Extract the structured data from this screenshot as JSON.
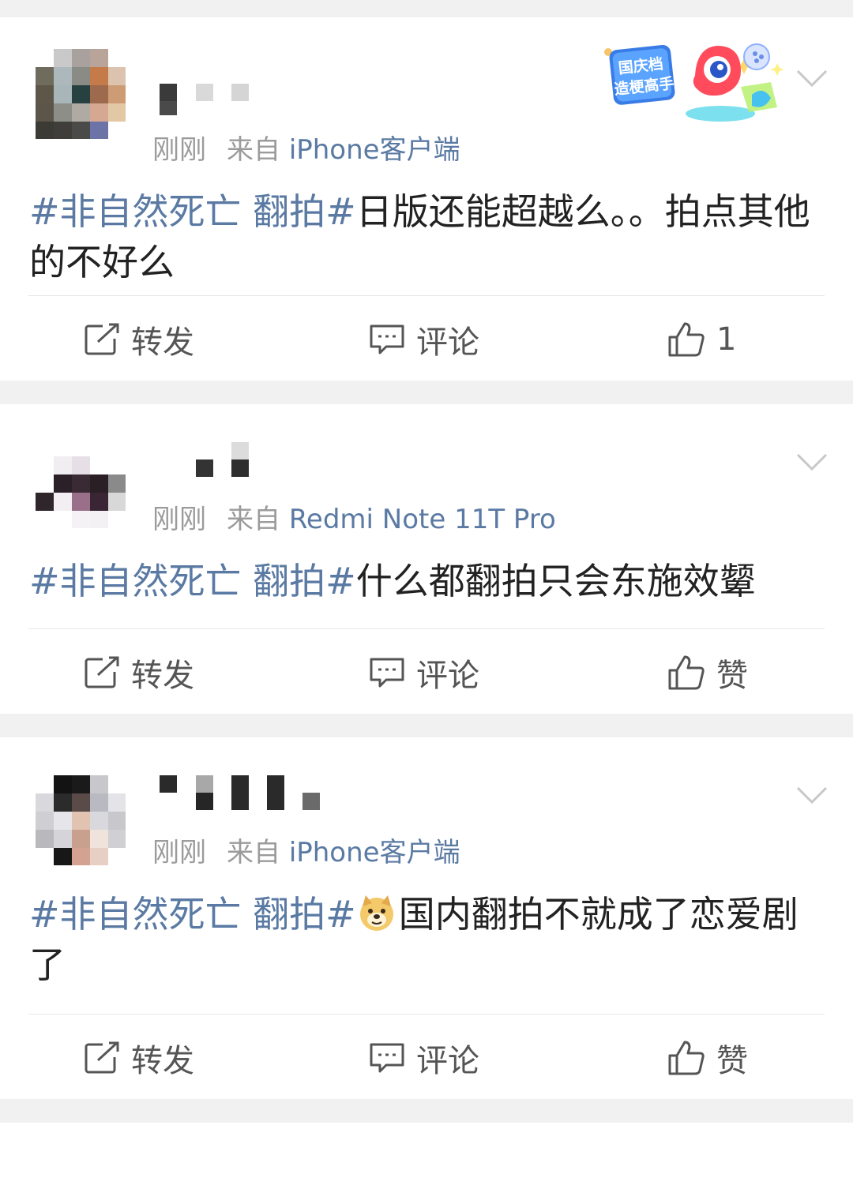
{
  "feed": {
    "posts": [
      {
        "time": "刚刚",
        "source_prefix": "来自",
        "source": "iPhone客户端",
        "hashtag": "#非自然死亡 翻拍#",
        "text": "日版还能超越么。。拍点其他的不好么",
        "badge": {
          "line1": "国庆档",
          "line2": "造梗高手"
        },
        "actions": {
          "repost": "转发",
          "comment": "评论",
          "like": "1"
        }
      },
      {
        "time": "刚刚",
        "source_prefix": "来自",
        "source": "Redmi Note 11T Pro",
        "hashtag": "#非自然死亡 翻拍#",
        "text": "什么都翻拍只会东施效颦",
        "actions": {
          "repost": "转发",
          "comment": "评论",
          "like": "赞"
        }
      },
      {
        "time": "刚刚",
        "source_prefix": "来自",
        "source": "iPhone客户端",
        "hashtag": "#非自然死亡 翻拍#",
        "emoji": "doge-emoji",
        "text": "国内翻拍不就成了恋爱剧了",
        "actions": {
          "repost": "转发",
          "comment": "评论",
          "like": "赞"
        }
      }
    ]
  },
  "colors": {
    "link": "#5a7aa3",
    "meta": "#9b9b9b",
    "text": "#222222",
    "action": "#555555",
    "separator": "#f1f1f1"
  },
  "icons": [
    "repost-icon",
    "comment-icon",
    "like-icon",
    "chevron-down-icon",
    "doge-emoji",
    "badge-mascot"
  ]
}
